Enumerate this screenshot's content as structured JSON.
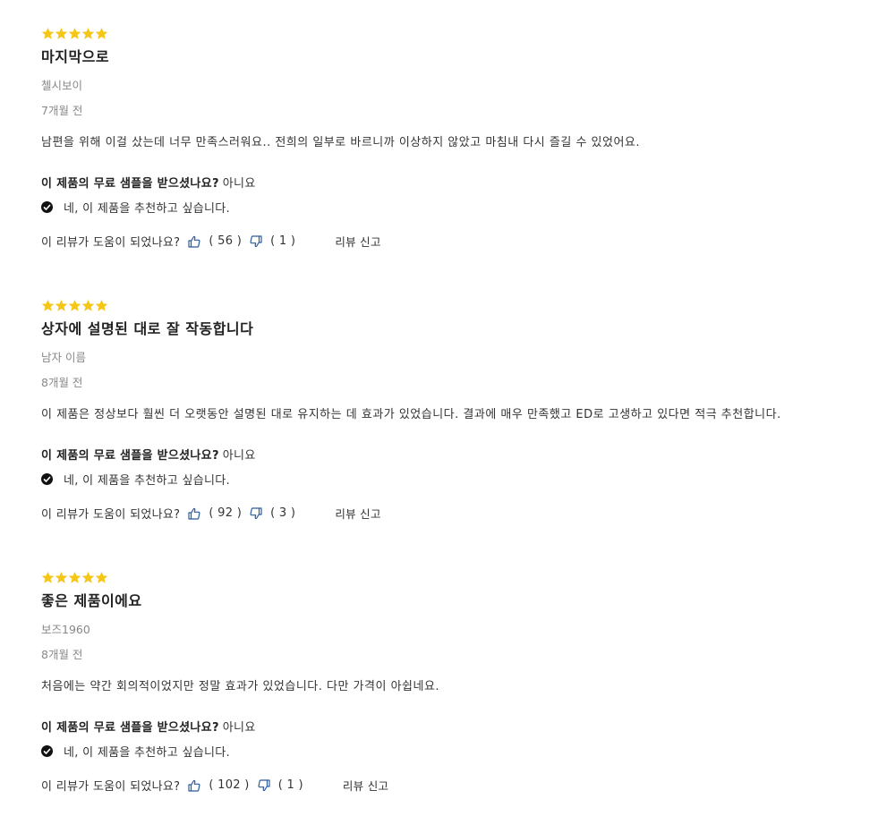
{
  "colors": {
    "star": "#f5c518",
    "thumb": "#2a5a9e",
    "check_bg": "#111111"
  },
  "icons": {
    "star": "star-icon",
    "check": "check-circle-icon",
    "thumb_up": "thumbs-up-icon",
    "thumb_down": "thumbs-down-icon"
  },
  "reviews": [
    {
      "rating": 5,
      "title": "마지막으로",
      "author": "첼시보이",
      "date": "7개월 전",
      "body": "남편을 위해 이걸 샀는데 너무 만족스러워요.. 전희의 일부로 바르니까 이상하지 않았고 마침내 다시 즐길 수 있었어요.",
      "sample_question": "이 제품의 무료 샘플을 받으셨나요?",
      "sample_answer": "아니요",
      "recommend": "네, 이 제품을 추천하고 싶습니다.",
      "helpful_question": "이 리뷰가 도움이 되었나요?",
      "helpful_up": "( 56 )",
      "helpful_down": "( 1 )",
      "report": "리뷰 신고"
    },
    {
      "rating": 5,
      "title": "상자에 설명된 대로 잘 작동합니다",
      "author": "남자 이름",
      "date": "8개월 전",
      "body": "이 제품은 정상보다 훨씬 더 오랫동안 설명된 대로 유지하는 데 효과가 있었습니다. 결과에 매우 만족했고 ED로 고생하고 있다면 적극 추천합니다.",
      "sample_question": "이 제품의 무료 샘플을 받으셨나요?",
      "sample_answer": "아니요",
      "recommend": "네, 이 제품을 추천하고 싶습니다.",
      "helpful_question": "이 리뷰가 도움이 되었나요?",
      "helpful_up": "( 92 )",
      "helpful_down": "( 3 )",
      "report": "리뷰 신고"
    },
    {
      "rating": 5,
      "title": "좋은 제품이에요",
      "author": "보즈1960",
      "date": "8개월 전",
      "body": "처음에는 약간 회의적이었지만 정말 효과가 있었습니다. 다만 가격이 아쉽네요.",
      "sample_question": "이 제품의 무료 샘플을 받으셨나요?",
      "sample_answer": "아니요",
      "recommend": "네, 이 제품을 추천하고 싶습니다.",
      "helpful_question": "이 리뷰가 도움이 되었나요?",
      "helpful_up": "( 102 )",
      "helpful_down": "( 1 )",
      "report": "리뷰 신고"
    }
  ]
}
